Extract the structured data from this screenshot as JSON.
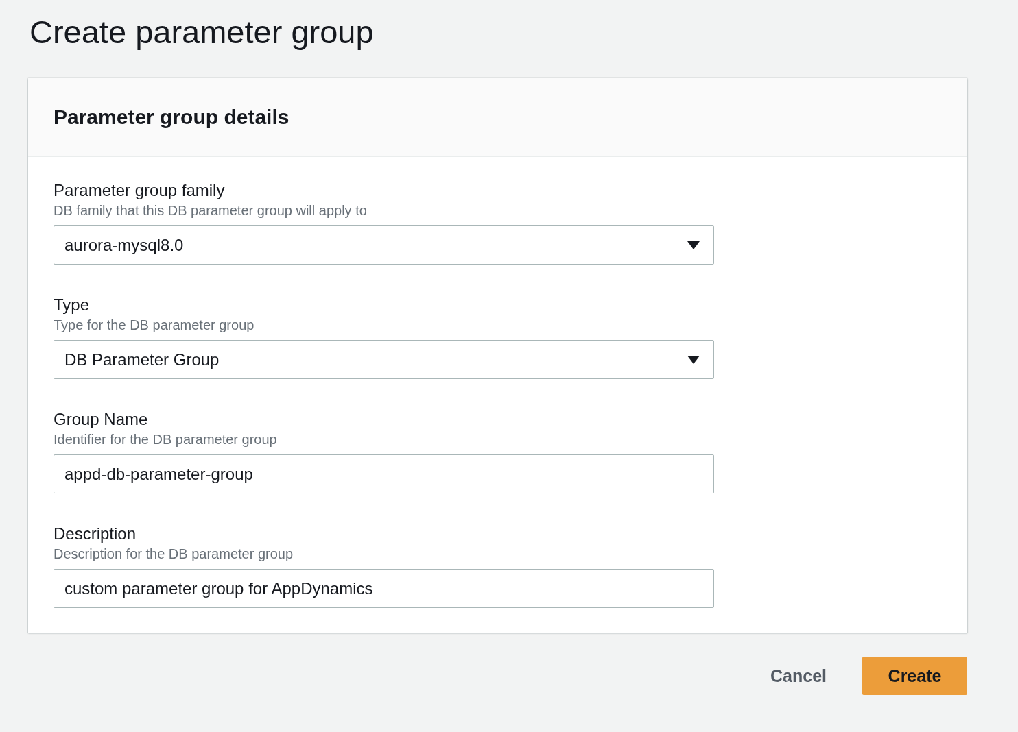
{
  "page_title": "Create parameter group",
  "panel": {
    "title": "Parameter group details",
    "fields": [
      {
        "kind": "select",
        "label": "Parameter group family",
        "hint": "DB family that this DB parameter group will apply to",
        "value": "aurora-mysql8.0"
      },
      {
        "kind": "select",
        "label": "Type",
        "hint": "Type for the DB parameter group",
        "value": "DB Parameter Group"
      },
      {
        "kind": "input",
        "label": "Group Name",
        "hint": "Identifier for the DB parameter group",
        "value": "appd-db-parameter-group"
      },
      {
        "kind": "input",
        "label": "Description",
        "hint": "Description for the DB parameter group",
        "value": "custom parameter group for AppDynamics"
      }
    ]
  },
  "buttons": [
    {
      "kind": "link",
      "label": "Cancel"
    },
    {
      "kind": "primary",
      "label": "Create"
    }
  ]
}
